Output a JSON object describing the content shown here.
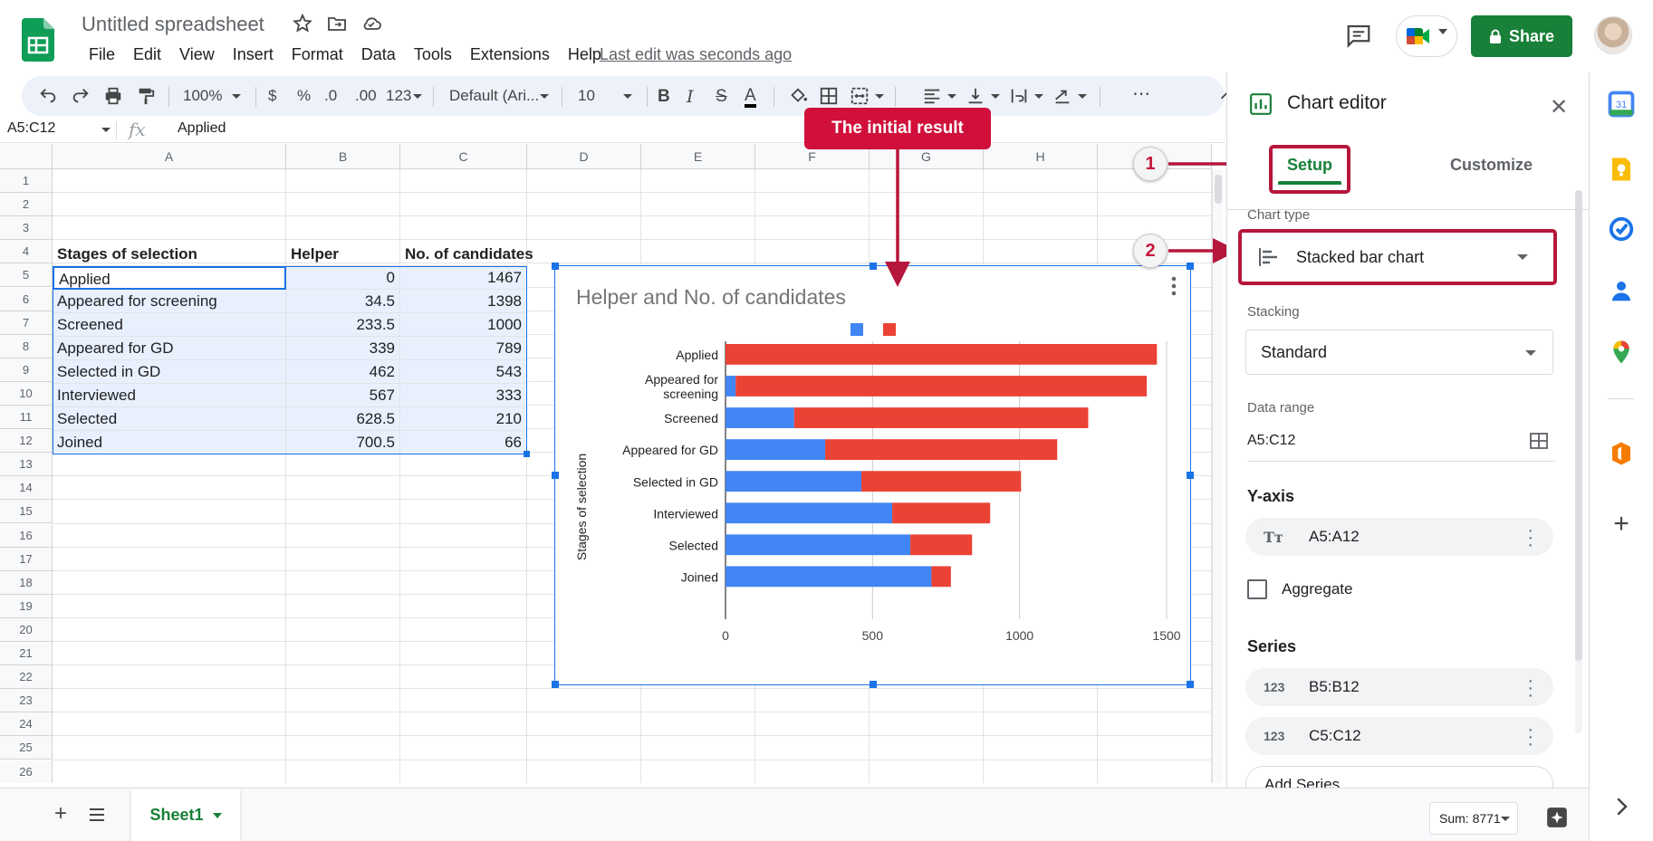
{
  "header": {
    "doc_title": "Untitled spreadsheet",
    "menu": [
      "File",
      "Edit",
      "View",
      "Insert",
      "Format",
      "Data",
      "Tools",
      "Extensions",
      "Help"
    ],
    "last_edit": "Last edit was seconds ago",
    "share_label": "Share"
  },
  "toolbar": {
    "zoom": "100%",
    "currency": "$",
    "percent": "%",
    "dec_decrease": ".0",
    "dec_increase": ".00",
    "format_123": "123",
    "font": "Default (Ari...",
    "font_size": "10",
    "bold": "B",
    "italic": "I",
    "strike": "S",
    "text_color": "A",
    "more": "⋯"
  },
  "formula_bar": {
    "name_box": "A5:C12",
    "fx": "fx",
    "value": "Applied"
  },
  "grid": {
    "columns": [
      "A",
      "B",
      "C",
      "D",
      "E",
      "F",
      "G",
      "H"
    ],
    "rows": [
      "1",
      "2",
      "3",
      "4",
      "5",
      "6",
      "7",
      "8",
      "9",
      "10",
      "11",
      "12",
      "13",
      "14",
      "15",
      "16",
      "17",
      "18",
      "19",
      "20",
      "21",
      "22",
      "23",
      "24",
      "25",
      "26"
    ],
    "header_row": [
      "Stages of selection",
      "Helper",
      "No. of candidates"
    ],
    "data": [
      [
        "Applied",
        "0",
        "1467"
      ],
      [
        "Appeared for screening",
        "34.5",
        "1398"
      ],
      [
        "Screened",
        "233.5",
        "1000"
      ],
      [
        "Appeared for GD",
        "339",
        "789"
      ],
      [
        "Selected in GD",
        "462",
        "543"
      ],
      [
        "Interviewed",
        "567",
        "333"
      ],
      [
        "Selected",
        "628.5",
        "210"
      ],
      [
        "Joined",
        "700.5",
        "66"
      ]
    ]
  },
  "chart_data": {
    "type": "bar",
    "orientation": "horizontal",
    "stacked": true,
    "title": "Helper and No. of candidates",
    "ylabel": "Stages of selection",
    "xlabel": "",
    "categories": [
      "Applied",
      "Appeared for screening",
      "Screened",
      "Appeared for GD",
      "Selected in GD",
      "Interviewed",
      "Selected",
      "Joined"
    ],
    "category_labels": [
      [
        "Applied"
      ],
      [
        "Appeared for",
        "screening"
      ],
      [
        "Screened"
      ],
      [
        "Appeared for GD"
      ],
      [
        "Selected in GD"
      ],
      [
        "Interviewed"
      ],
      [
        "Selected"
      ],
      [
        "Joined"
      ]
    ],
    "series": [
      {
        "values": [
          0,
          34.5,
          233.5,
          339,
          462,
          567,
          628.5,
          700.5
        ],
        "color": "#4285f4"
      },
      {
        "values": [
          1467,
          1398,
          1000,
          789,
          543,
          333,
          210,
          66
        ],
        "color": "#ea4335"
      }
    ],
    "xlim": [
      0,
      1500
    ],
    "xticks": [
      "0",
      "500",
      "1000",
      "1500"
    ],
    "xtick_values": [
      0,
      500,
      1000,
      1500
    ],
    "grid": true,
    "legend": "top"
  },
  "annotations": {
    "callout": "The initial result",
    "marker1": "1",
    "marker2": "2"
  },
  "editor": {
    "title": "Chart editor",
    "tab_setup": "Setup",
    "tab_customize": "Customize",
    "chart_type_label": "Chart type",
    "chart_type_value": "Stacked bar chart",
    "stacking_label": "Stacking",
    "stacking_value": "Standard",
    "data_range_label": "Data range",
    "data_range_value": "A5:C12",
    "y_axis_heading": "Y-axis",
    "y_axis_value": "A5:A12",
    "aggregate_label": "Aggregate",
    "series_heading": "Series",
    "series": [
      "B5:B12",
      "C5:C12"
    ],
    "add_series": "Add Series"
  },
  "bottom": {
    "sheet_tab": "Sheet1",
    "sum": "Sum: 8771"
  },
  "colors": {
    "accent_green": "#188038",
    "selection_blue": "#1a73e8",
    "annotation_red": "#b5163b",
    "series_blue": "#4285f4",
    "series_red": "#ea4335"
  }
}
